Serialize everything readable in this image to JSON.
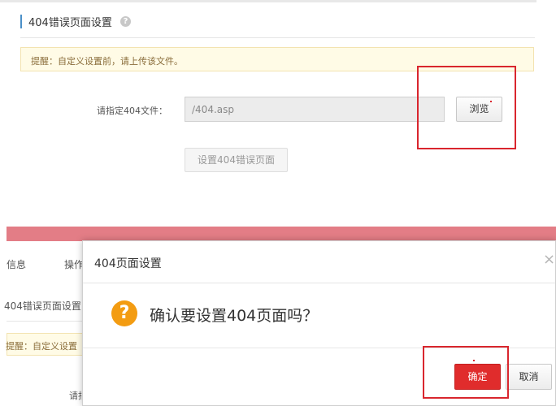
{
  "settings": {
    "section_title": "404错误页面设置",
    "help_icon": "?",
    "tip": "提醒：自定义设置前，请上传该文件。",
    "file_label": "请指定404文件：",
    "file_value": "/404.asp",
    "browse_label": "浏览",
    "set_button_label": "设置404错误页面"
  },
  "background": {
    "tab_info": "信息",
    "tab_ops_partial": "操作",
    "title_partial": "404错误页面设置",
    "tip_partial": "提醒：自定义设置",
    "label_partial": "请指"
  },
  "dialog": {
    "title": "404页面设置",
    "close_symbol": "×",
    "question_symbol": "?",
    "message": "确认要设置404页面吗？",
    "ok_label": "确定",
    "cancel_label": "取消"
  },
  "colors": {
    "accent_red": "#e02c2c",
    "highlight_red": "#d9262e",
    "warning_orange": "#f39c12",
    "pink_band": "#e37d86"
  }
}
